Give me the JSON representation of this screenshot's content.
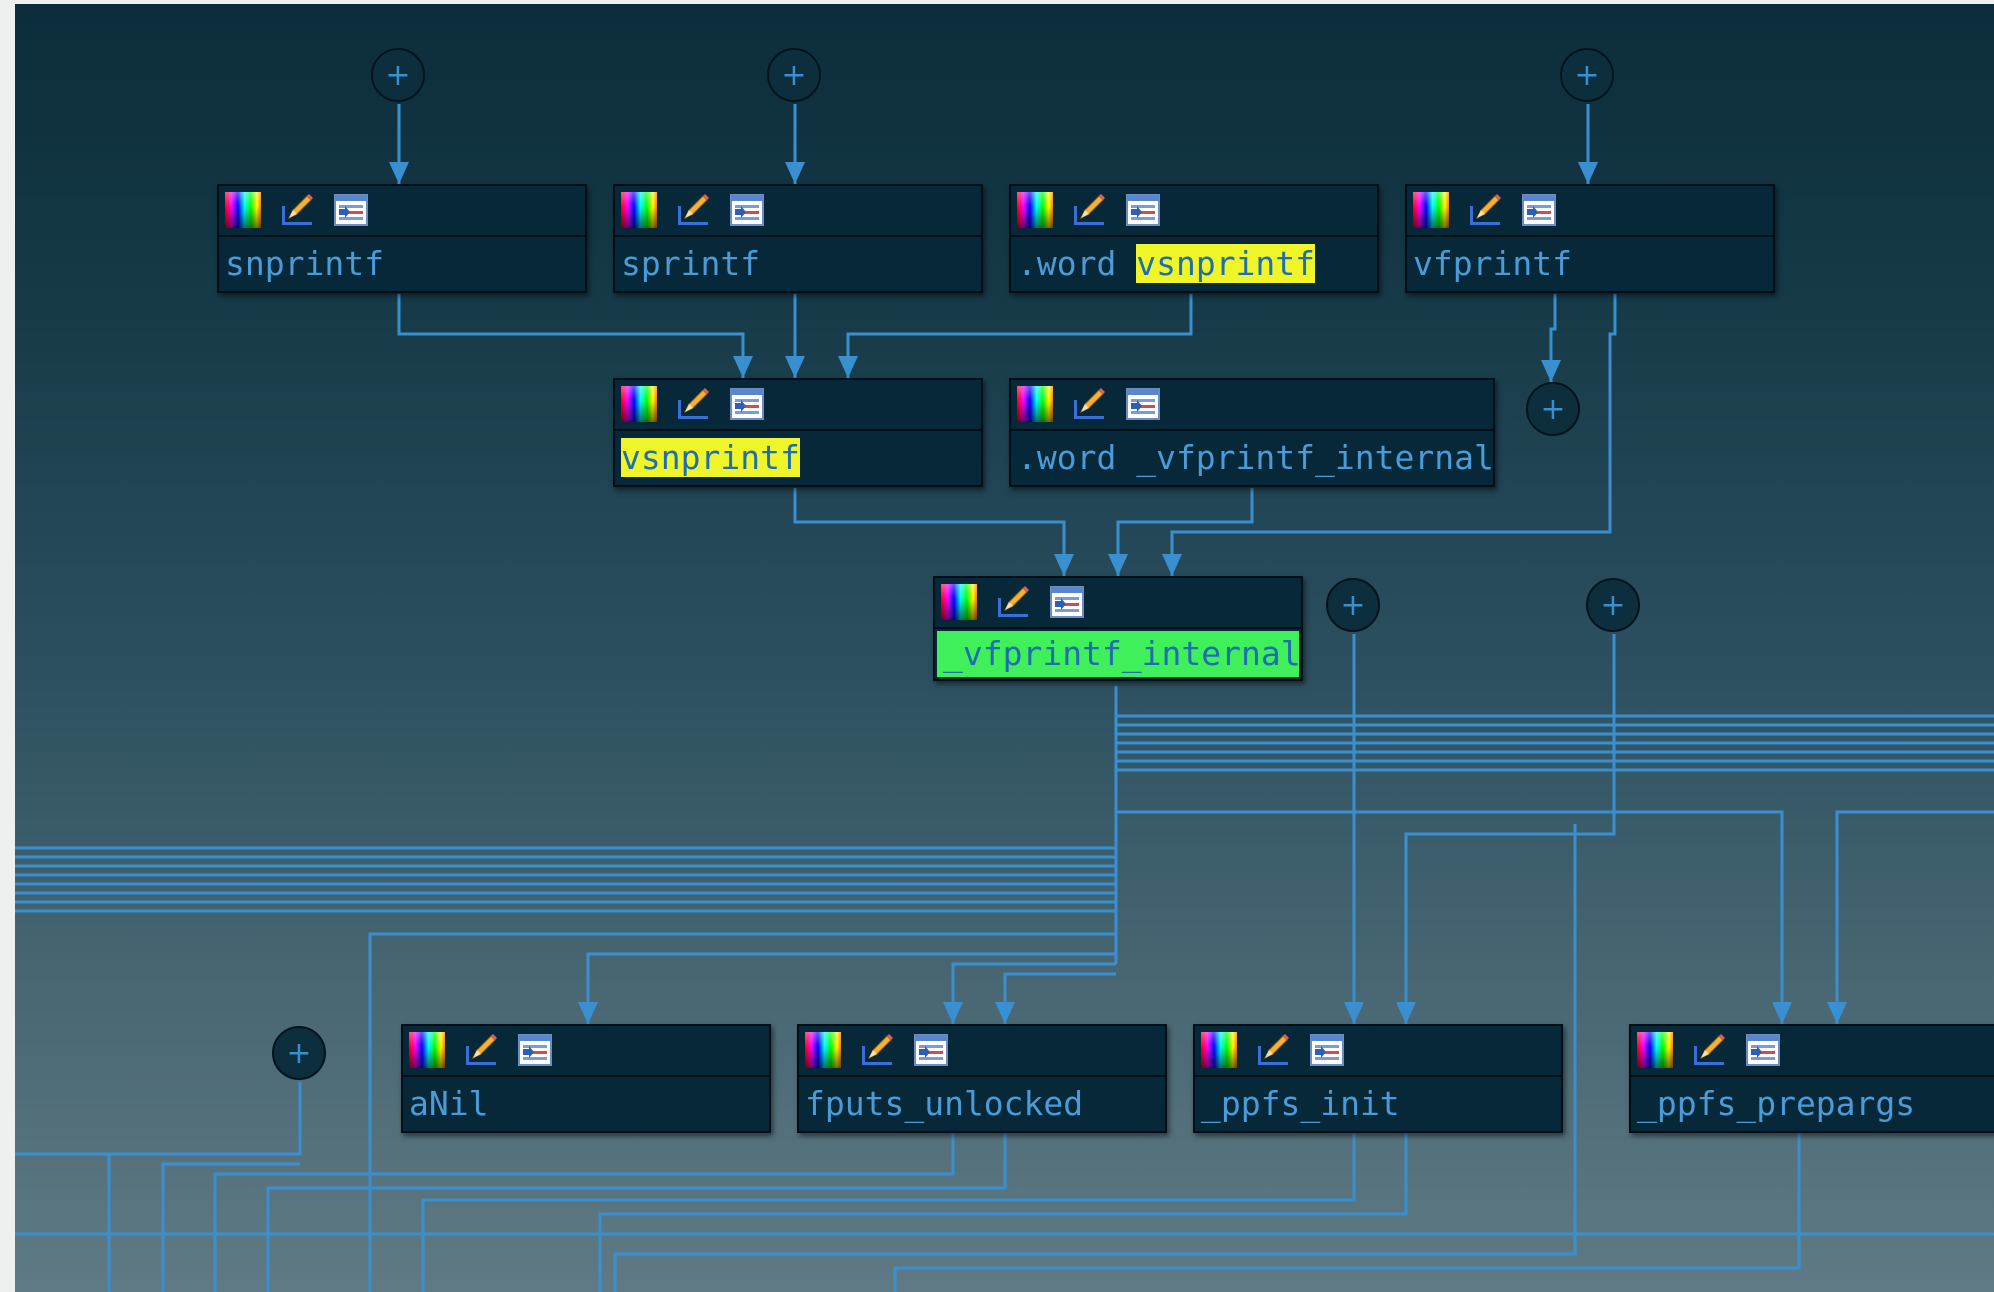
{
  "graph": {
    "nodes": [
      {
        "label": "snprintf"
      },
      {
        "label": "sprintf"
      },
      {
        "prefix": ".word ",
        "highlight": "vsnprintf"
      },
      {
        "label": "vfprintf"
      },
      {
        "highlight": "vsnprintf"
      },
      {
        "label": ".word _vfprintf_internal"
      },
      {
        "label": "_vfprintf_internal"
      },
      {
        "label": "aNil"
      },
      {
        "label": "fputs_unlocked"
      },
      {
        "label": "_ppfs_init"
      },
      {
        "label": "_ppfs_prepargs"
      }
    ],
    "expand_button_symbol": "+",
    "icons": [
      "color-palette-icon",
      "edit-pencil-icon",
      "xref-list-icon"
    ]
  },
  "colors": {
    "edge": "#3a8fd0",
    "highlight": "#f0f52a",
    "current": "#3ff05a",
    "node_bg": "#072838"
  }
}
